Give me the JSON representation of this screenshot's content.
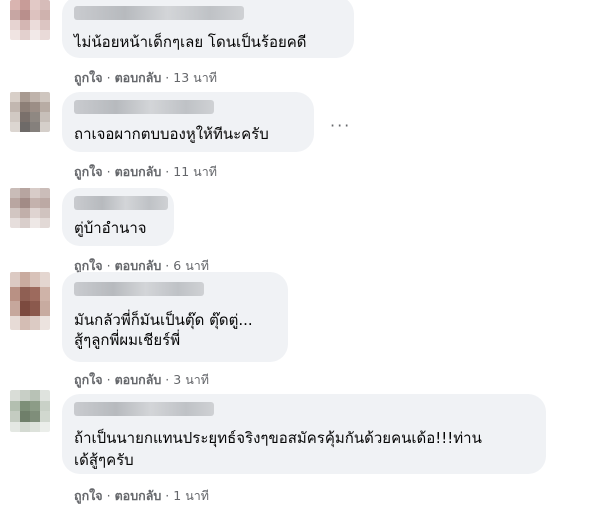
{
  "comments": [
    {
      "text": "ไม่น้อยหน้าเด็กๆเลย โดนเป็นร้อยคดี",
      "like_label": "ถูกใจ",
      "reply_label": "ตอบกลับ",
      "time": "13 นาที"
    },
    {
      "text": "ถาเจอผากตบบองหูให้ทีนะครับ",
      "like_label": "ถูกใจ",
      "reply_label": "ตอบกลับ",
      "time": "11 นาที"
    },
    {
      "text": "ตู่บ้าอำนาจ",
      "like_label": "ถูกใจ",
      "reply_label": "ตอบกลับ",
      "time": "6 นาที"
    },
    {
      "text_line1": "มันกลัวพี่ก็มันเป็นตุ๊ด ตุ๊ดตู่...",
      "text_line2": "สู้ๆลูกพี่ผมเชียร์พี่",
      "like_label": "ถูกใจ",
      "reply_label": "ตอบกลับ",
      "time": "3 นาที"
    },
    {
      "text_line1": "ถ้าเป็นนายกแทนประยุทธ์จริงๆขอสมัครคุ้มกันด้วยคนเด้อ!!!ท่าน",
      "text_line2": "เด้สู้ๆครับ",
      "like_label": "ถูกใจ",
      "reply_label": "ตอบกลับ",
      "time": "1 นาที"
    }
  ],
  "separator": "·",
  "more_options": "···"
}
